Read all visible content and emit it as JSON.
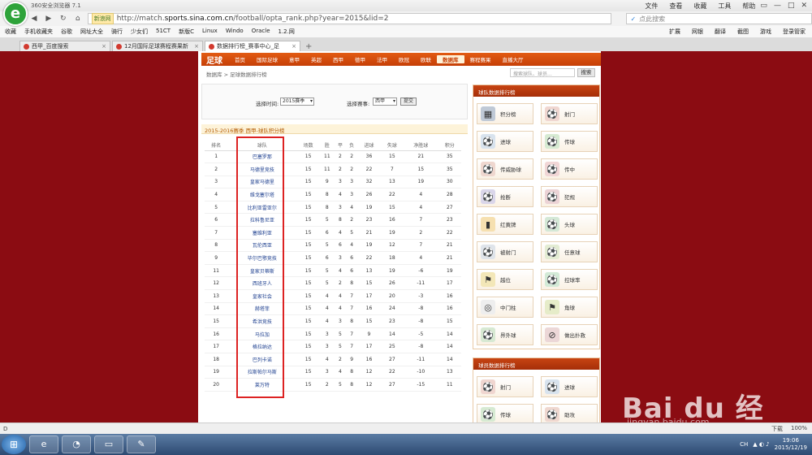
{
  "browser": {
    "logo_letter": "e",
    "title": "360安全浏览器 7.1",
    "menus": [
      "文件",
      "查看",
      "收藏",
      "工具",
      "帮助"
    ],
    "window_buttons": [
      "▭",
      "—",
      "□",
      "✕"
    ],
    "url_tag": "新浪网",
    "url_prefix": "http://match.",
    "url_domain": "sports.sina.com.cn",
    "url_suffix": "/football/opta_rank.php?year=2015&lid=2",
    "search_placeholder": "点此搜索",
    "favorites": [
      "收藏",
      "手机收藏夹",
      "谷歌",
      "网址大全",
      "骑行",
      "少女们",
      "51CT",
      "新版C",
      "Linux",
      "Windo",
      "Oracle",
      "1.2.网"
    ],
    "toolbar_right": [
      "扩展",
      "网银",
      "翻译",
      "截图",
      "游戏",
      "登录管家"
    ],
    "tabs": [
      {
        "label": "西甲_百度搜索",
        "active": false
      },
      {
        "label": "12月国际足球赛程赛果新",
        "active": false
      },
      {
        "label": "数据排行榜_赛事中心_足",
        "active": true
      }
    ]
  },
  "site": {
    "brand": "足球",
    "nav": [
      "首页",
      "国际足球",
      "意甲",
      "英超",
      "西甲",
      "德甲",
      "法甲",
      "欧冠",
      "欧联",
      "数据库",
      "赛程赛果",
      "直播大厅"
    ],
    "nav_active": "数据库",
    "breadcrumb": "数据库 > 足球数据排行榜",
    "search_placeholder": "搜索球队、球员...",
    "search_button": "搜索"
  },
  "filter": {
    "time_label": "选择时间:",
    "time_value": "2015赛季",
    "league_label": "选择赛事:",
    "league_value": "西甲",
    "submit": "提交"
  },
  "table": {
    "caption": "2015-2016赛季 西甲-球队积分榜",
    "headers": [
      "排名",
      "球队",
      "场数",
      "胜",
      "平",
      "负",
      "进球",
      "失球",
      "净胜球",
      "积分"
    ],
    "rows": [
      [
        "1",
        "巴塞罗那",
        "15",
        "11",
        "2",
        "2",
        "36",
        "15",
        "21",
        "35"
      ],
      [
        "2",
        "马德里竞技",
        "15",
        "11",
        "2",
        "2",
        "22",
        "7",
        "15",
        "35"
      ],
      [
        "3",
        "皇家马德里",
        "15",
        "9",
        "3",
        "3",
        "32",
        "13",
        "19",
        "30"
      ],
      [
        "4",
        "维戈塞尔塔",
        "15",
        "8",
        "4",
        "3",
        "26",
        "22",
        "4",
        "28"
      ],
      [
        "5",
        "比利亚雷亚尔",
        "15",
        "8",
        "3",
        "4",
        "19",
        "15",
        "4",
        "27"
      ],
      [
        "6",
        "拉科鲁尼亚",
        "15",
        "5",
        "8",
        "2",
        "23",
        "16",
        "7",
        "23"
      ],
      [
        "7",
        "塞维利亚",
        "15",
        "6",
        "4",
        "5",
        "21",
        "19",
        "2",
        "22"
      ],
      [
        "8",
        "瓦伦西亚",
        "15",
        "5",
        "6",
        "4",
        "19",
        "12",
        "7",
        "21"
      ],
      [
        "9",
        "毕尔巴鄂竞技",
        "15",
        "6",
        "3",
        "6",
        "22",
        "18",
        "4",
        "21"
      ],
      [
        "11",
        "皇家贝蒂斯",
        "15",
        "5",
        "4",
        "6",
        "13",
        "19",
        "-6",
        "19"
      ],
      [
        "12",
        "西班牙人",
        "15",
        "5",
        "2",
        "8",
        "15",
        "26",
        "-11",
        "17"
      ],
      [
        "13",
        "皇家社会",
        "15",
        "4",
        "4",
        "7",
        "17",
        "20",
        "-3",
        "16"
      ],
      [
        "14",
        "赫塔菲",
        "15",
        "4",
        "4",
        "7",
        "16",
        "24",
        "-8",
        "16"
      ],
      [
        "15",
        "希洪竞技",
        "15",
        "4",
        "3",
        "8",
        "15",
        "23",
        "-8",
        "15"
      ],
      [
        "16",
        "马拉加",
        "15",
        "3",
        "5",
        "7",
        "9",
        "14",
        "-5",
        "14"
      ],
      [
        "17",
        "格拉纳达",
        "15",
        "3",
        "5",
        "7",
        "17",
        "25",
        "-8",
        "14"
      ],
      [
        "18",
        "巴列卡诺",
        "15",
        "4",
        "2",
        "9",
        "16",
        "27",
        "-11",
        "14"
      ],
      [
        "19",
        "拉斯帕尔马斯",
        "15",
        "3",
        "4",
        "8",
        "12",
        "22",
        "-10",
        "13"
      ],
      [
        "20",
        "莱万特",
        "15",
        "2",
        "5",
        "8",
        "12",
        "27",
        "-15",
        "11"
      ]
    ]
  },
  "team_panel": {
    "title": "球队数据排行榜",
    "tiles": [
      {
        "label": "积分榜",
        "icon": "table-icon",
        "glyph": "▦",
        "color": "#bfc9d6"
      },
      {
        "label": "射门",
        "icon": "shot-icon",
        "glyph": "⚽",
        "color": "#f0d6d0"
      },
      {
        "label": "进球",
        "icon": "goal-icon",
        "glyph": "⚽",
        "color": "#d8e3ee"
      },
      {
        "label": "传球",
        "icon": "pass-icon",
        "glyph": "⚽",
        "color": "#d6ead2"
      },
      {
        "label": "传威胁球",
        "icon": "key-pass-icon",
        "glyph": "⚽",
        "color": "#efd7cf"
      },
      {
        "label": "传中",
        "icon": "cross-icon",
        "glyph": "⚽",
        "color": "#f1d6d6"
      },
      {
        "label": "抢断",
        "icon": "tackle-icon",
        "glyph": "⚽",
        "color": "#dad6ea"
      },
      {
        "label": "犯规",
        "icon": "foul-icon",
        "glyph": "⚽",
        "color": "#ecd3d6"
      },
      {
        "label": "红黄牌",
        "icon": "card-icon",
        "glyph": "▮",
        "color": "#f6e0b0"
      },
      {
        "label": "头球",
        "icon": "header-icon",
        "glyph": "⚽",
        "color": "#d4e8d6"
      },
      {
        "label": "被射门",
        "icon": "shots-against-icon",
        "glyph": "⚽",
        "color": "#dfe4ea"
      },
      {
        "label": "任意球",
        "icon": "free-kick-icon",
        "glyph": "⚽",
        "color": "#e3ecd3"
      },
      {
        "label": "越位",
        "icon": "offside-icon",
        "glyph": "⚑",
        "color": "#f3e7b8"
      },
      {
        "label": "控球率",
        "icon": "possession-icon",
        "glyph": "⚽",
        "color": "#d3ead7"
      },
      {
        "label": "中门柱",
        "icon": "post-icon",
        "glyph": "◎",
        "color": "#eeeeee"
      },
      {
        "label": "角球",
        "icon": "corner-icon",
        "glyph": "⚑",
        "color": "#e6ecc9"
      },
      {
        "label": "界外球",
        "icon": "throw-in-icon",
        "glyph": "⚽",
        "color": "#d7e9d2"
      },
      {
        "label": "做出扑救",
        "icon": "save-icon",
        "glyph": "⊘",
        "color": "#ecd7d7"
      }
    ]
  },
  "player_panel": {
    "title": "球员数据排行榜",
    "tiles": [
      {
        "label": "射门",
        "icon": "player-shot-icon",
        "glyph": "⚽",
        "color": "#f0d6d0"
      },
      {
        "label": "进球",
        "icon": "player-goal-icon",
        "glyph": "⚽",
        "color": "#d8e3ee"
      },
      {
        "label": "传球",
        "icon": "player-pass-icon",
        "glyph": "⚽",
        "color": "#d6ead2"
      },
      {
        "label": "助攻",
        "icon": "assist-icon",
        "glyph": "⚽",
        "color": "#efd7cf"
      }
    ]
  },
  "watermark": {
    "text": "Bai du 经验",
    "sub": "jingyan.baidu.com"
  },
  "statusbar": {
    "left": "D",
    "right": [
      "下载",
      "100%"
    ]
  },
  "taskbar": {
    "time": "19:06",
    "date": "2015/12/19",
    "lang": "CH"
  }
}
